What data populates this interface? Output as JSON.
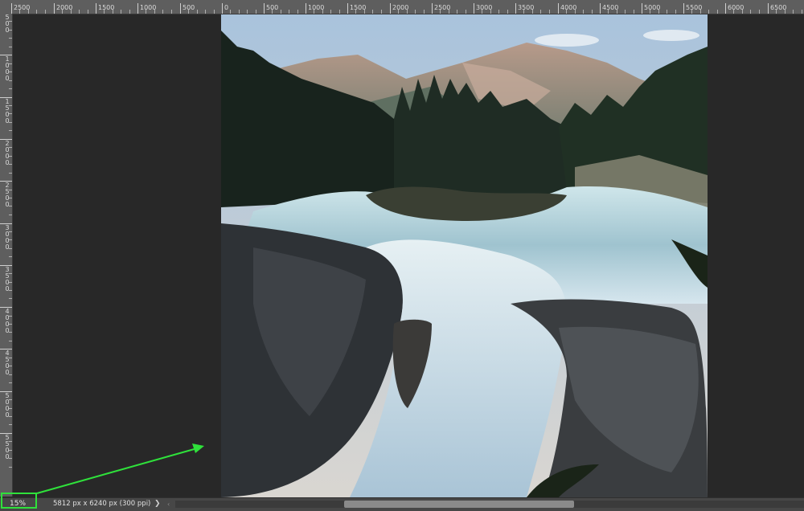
{
  "ruler": {
    "h_labels": [
      "2500",
      "2000",
      "1500",
      "1000",
      "500",
      "0",
      "500",
      "1000",
      "1500",
      "2000",
      "2500",
      "3000",
      "3500",
      "4000",
      "4500",
      "5000",
      "5500",
      "6000",
      "6500"
    ],
    "v_labels": [
      "500",
      "1000",
      "1500",
      "2000",
      "2500",
      "3000",
      "3500",
      "4000",
      "4500",
      "5000",
      "5500"
    ]
  },
  "canvas": {
    "image_name": "waterfall-photo"
  },
  "status_bar": {
    "zoom": "15%",
    "doc_info": "5812 px x 6240 px (300 ppi)",
    "chevron": "❯",
    "scroll_left_arrow": "‹"
  },
  "colors": {
    "annotation": "#2fe13b",
    "background": "#282828",
    "ruler": "#5e5e5e"
  }
}
